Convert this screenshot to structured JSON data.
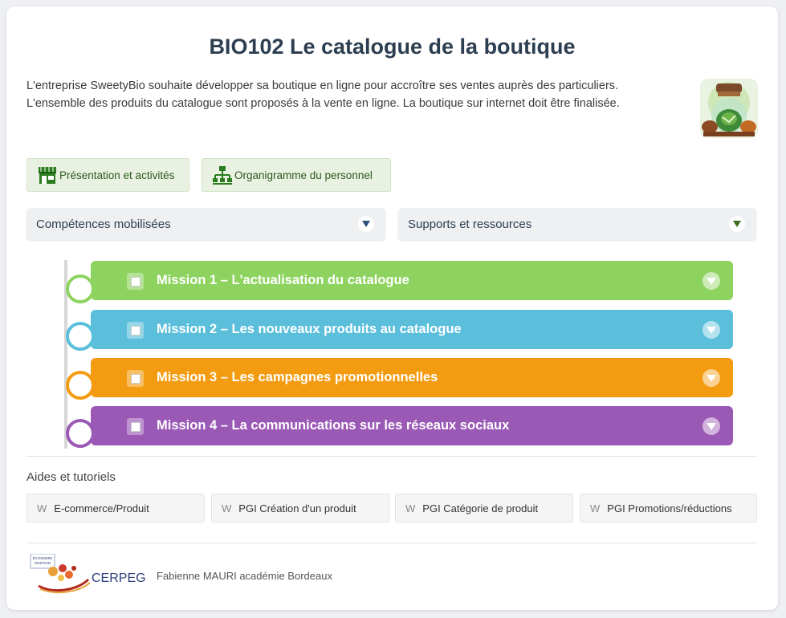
{
  "page": {
    "title": "BIO102 Le catalogue de la boutique",
    "intro": [
      "L'entreprise SweetyBio souhaite développer sa boutique en ligne pour accroître ses ventes auprès des particuliers.",
      "L'ensemble des produits du catalogue sont proposés à la vente en ligne. La boutique sur internet doit être finalisée."
    ]
  },
  "info_buttons": [
    {
      "label": "Présentation et activités",
      "icon": "shop-icon"
    },
    {
      "label": "Organigramme du personnel",
      "icon": "org-chart-icon"
    }
  ],
  "dropdowns": [
    {
      "label": "Compétences mobilisées",
      "caret_color": "#2d4f7a"
    },
    {
      "label": "Supports et ressources",
      "caret_color": "#3d6b1f"
    }
  ],
  "missions": [
    {
      "label": "Mission 1 – L'actualisation du catalogue",
      "color": "#8ed35f"
    },
    {
      "label": "Mission 2 – Les nouveaux produits au catalogue",
      "color": "#5bbfdc"
    },
    {
      "label": "Mission 3 – Les campagnes promotionnelles",
      "color": "#f39c12"
    },
    {
      "label": "Mission 4 – La communications sur les réseaux sociaux",
      "color": "#9b59b6"
    }
  ],
  "aides": {
    "title": "Aides et tutoriels",
    "items": [
      {
        "prefix": "W",
        "label": "E-commerce/Produit"
      },
      {
        "prefix": "W",
        "label": "PGI Création d'un produit"
      },
      {
        "prefix": "W",
        "label": "PGI Catégorie de produit"
      },
      {
        "prefix": "W",
        "label": "PGI Promotions/réductions"
      }
    ]
  },
  "footer": {
    "logo_text": "CERPEG",
    "logo_small_text": "ÉCONOMIE GESTION",
    "author": "Fabienne MAURI académie Bordeaux"
  }
}
